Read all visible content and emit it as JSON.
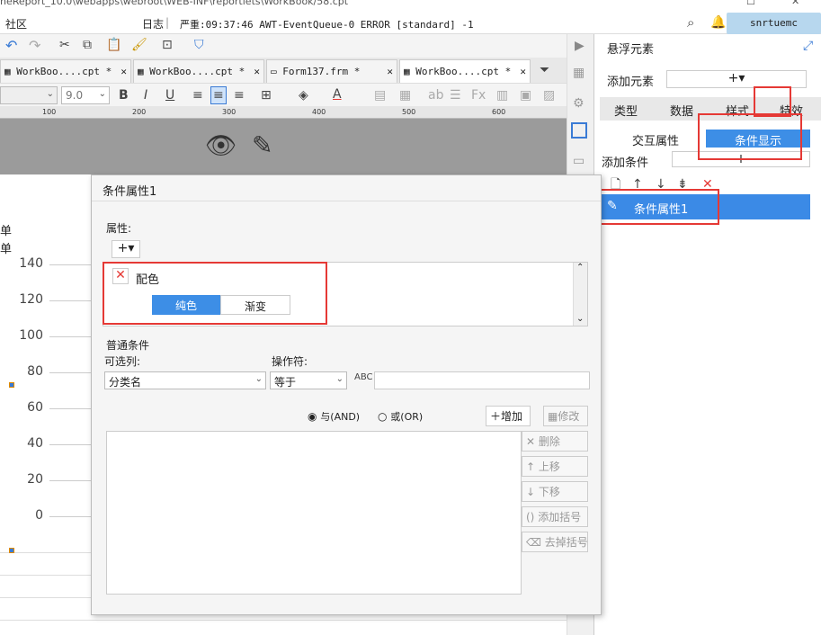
{
  "window": {
    "title": "neReport_10.0\\webapps\\webroot\\WEB-INF\\reportlets\\WorkBook/58.cpt"
  },
  "menubar": {
    "community": "社区",
    "log_label": "日志",
    "log_message": "严重:09:37:46 AWT-EventQueue-0 ERROR [standard] -1",
    "username": "snrtuemc"
  },
  "tabs": [
    {
      "label": "WorkBoo....cpt *"
    },
    {
      "label": "WorkBoo....cpt *"
    },
    {
      "label": "Form137.frm *"
    },
    {
      "label": "WorkBoo....cpt *"
    }
  ],
  "format": {
    "font_size": "9.0"
  },
  "ruler": {
    "ticks": [
      "100",
      "200",
      "300",
      "400",
      "500",
      "600"
    ]
  },
  "chart_axis": {
    "values": [
      "140",
      "120",
      "100",
      "80",
      "60",
      "40",
      "20",
      "0"
    ]
  },
  "sheet": {
    "cell1": "单",
    "cell2": "单"
  },
  "panel": {
    "title": "悬浮元素",
    "add_element_label": "添加元素",
    "tabs": [
      "类型",
      "数据",
      "样式",
      "特效"
    ],
    "subtabs": [
      "交互属性",
      "条件显示"
    ],
    "add_condition_label": "添加条件",
    "condition_item": "条件属性1"
  },
  "dialog": {
    "title": "条件属性1",
    "attr_label": "属性:",
    "color_item": "配色",
    "color_modes": [
      "纯色",
      "渐变"
    ],
    "normal_condition_label": "普通条件",
    "optional_column_label": "可选列:",
    "operator_label": "操作符:",
    "column_value": "分类名",
    "operator_value": "等于",
    "and_label": "与(AND)",
    "or_label": "或(OR)",
    "add_button": "增加",
    "modify_button": "修改",
    "delete_button": "删除",
    "up_button": "上移",
    "down_button": "下移",
    "add_bracket_button": "添加括号",
    "remove_bracket_button": "去掉括号"
  },
  "colors": {
    "accent": "#3d8ee6",
    "selection": "#3b8ae6",
    "red_highlight": "#e53935"
  }
}
